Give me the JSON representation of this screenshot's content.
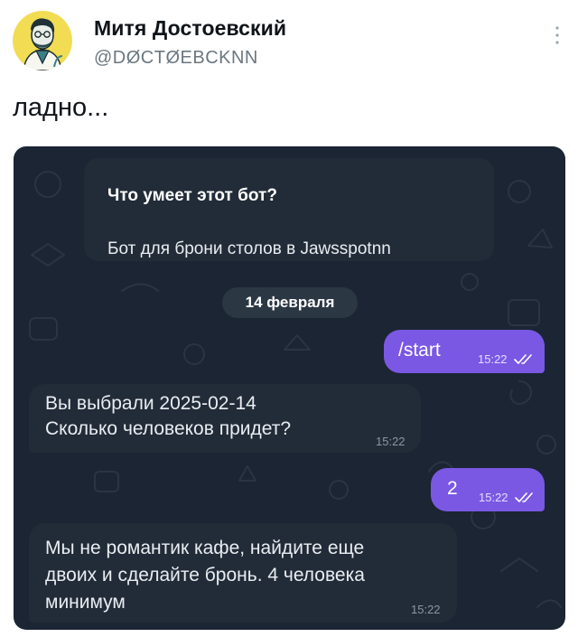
{
  "tweet": {
    "author_name": "Митя Достоевский",
    "author_handle": "@DØCTØEBCKNN",
    "text": "ладно..."
  },
  "chat": {
    "bot_info": {
      "title": "Что умеет этот бот?",
      "description": "Бот для брони столов в Jawsspotnn"
    },
    "date_separator": "14 февраля",
    "messages": [
      {
        "direction": "out",
        "text": "/start",
        "time": "15:22",
        "status": "read"
      },
      {
        "direction": "in",
        "text": "Вы выбрали 2025-02-14\nСколько человеков придет?",
        "time": "15:22"
      },
      {
        "direction": "out",
        "text": "2",
        "time": "15:22",
        "status": "read"
      },
      {
        "direction": "in",
        "text": "Мы не романтик кафе, найдите еще\nдвоих и сделайте бронь. 4 человека\nминимум",
        "time": "15:22"
      }
    ]
  },
  "colors": {
    "chat_background": "#1b2533",
    "incoming_bubble": "#222c38",
    "outgoing_bubble": "#7a58e3",
    "avatar_background": "#f2dc53"
  },
  "icons": [
    "more-vertical-icon",
    "double-check-icon"
  ]
}
